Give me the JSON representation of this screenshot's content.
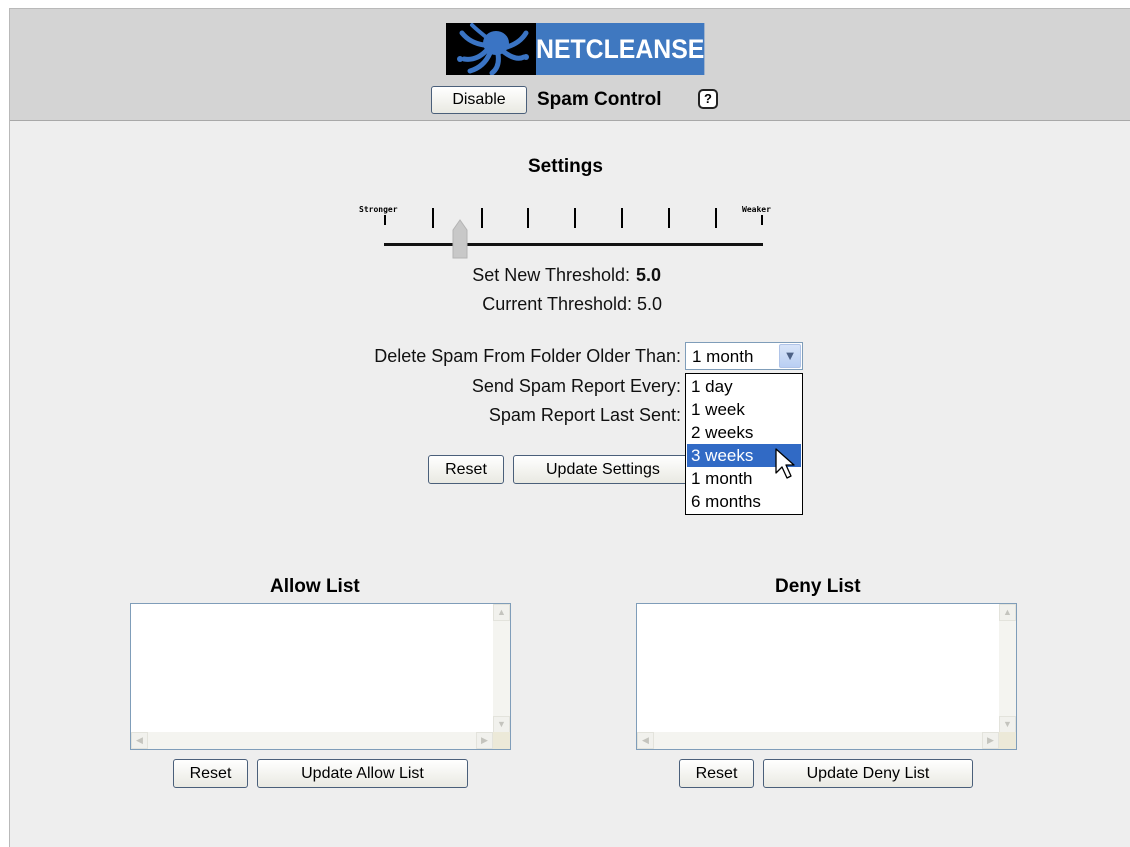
{
  "header": {
    "logo_text": "NETCLEANSE",
    "logo_icon": "octopus-logo-icon",
    "disable_label": "Disable",
    "title": "Spam Control",
    "help_glyph": "?"
  },
  "settings": {
    "heading": "Settings",
    "slider": {
      "stronger_label": "Stronger",
      "weaker_label": "Weaker",
      "level_fraction": 0.2
    },
    "set_threshold_label": "Set New Threshold:",
    "set_threshold_value": "5.0",
    "current_threshold_label": "Current Threshold:",
    "current_threshold_value": "5.0",
    "delete_label": "Delete Spam From Folder Older Than:",
    "delete_select_value": "1 month",
    "delete_options": [
      "1 day",
      "1 week",
      "2 weeks",
      "3 weeks",
      "1 month",
      "6 months"
    ],
    "highlighted_option": "3 weeks",
    "report_every_label": "Send Spam Report Every:",
    "report_last_label": "Spam Report Last Sent:",
    "reset_label": "Reset",
    "update_label": "Update Settings"
  },
  "allow_list": {
    "title": "Allow List",
    "reset_label": "Reset",
    "update_label": "Update Allow List"
  },
  "deny_list": {
    "title": "Deny List",
    "reset_label": "Reset",
    "update_label": "Update Deny List"
  },
  "colors": {
    "logo_blue": "#3f78c0",
    "selection_blue": "#316ac5",
    "panel_gray": "#eeeeee",
    "header_gray": "#d4d4d4"
  }
}
